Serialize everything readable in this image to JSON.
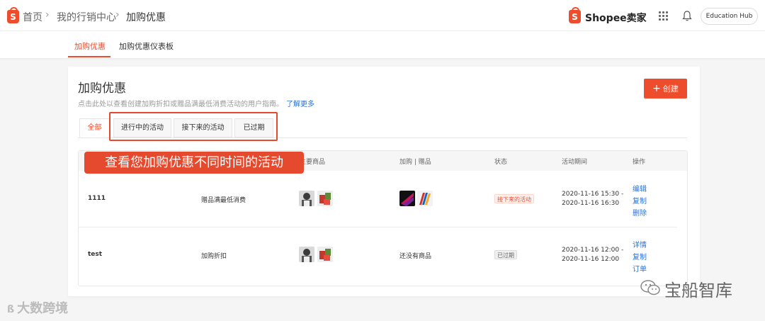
{
  "header": {
    "breadcrumbs": [
      "首页",
      "我的行销中心",
      "加购优惠"
    ],
    "brand": "Shopee卖家",
    "hub_button": "Education Hub",
    "icons": [
      "shopee-logo-icon",
      "grid-apps-icon",
      "bell-icon"
    ]
  },
  "subnav": {
    "tabs": [
      {
        "label": "加购优惠",
        "active": true
      },
      {
        "label": "加购优惠仪表板",
        "active": false
      }
    ]
  },
  "page": {
    "title": "加购优惠",
    "description": "点击此处以查看创建加购折扣或赠品满最低消费活动的用户指南。",
    "learn_more": "了解更多",
    "create_button": "创建"
  },
  "status_tabs": [
    {
      "label": "全部",
      "active": true
    },
    {
      "label": "进行中的活动",
      "active": false
    },
    {
      "label": "接下来的活动",
      "active": false
    },
    {
      "label": "已过期",
      "active": false
    }
  ],
  "callout": "查看您加购优惠不同时间的活动",
  "table": {
    "columns": [
      "主要商品",
      "加购 | 赠品",
      "状态",
      "活动期间",
      "操作"
    ],
    "rows": [
      {
        "name": "1111",
        "type": "赠品满最低消费",
        "addon_text": "",
        "status": "接下来的活动",
        "status_color": "#ee4d2d",
        "period_start": "2020-11-16 15:30 -",
        "period_end": "2020-11-16 16:30",
        "actions": [
          "编辑",
          "复制",
          "删除"
        ]
      },
      {
        "name": "test",
        "type": "加购折扣",
        "addon_text": "还没有商品",
        "status": "已过期",
        "status_color": "#666666",
        "period_start": "2020-11-16 12:00 -",
        "period_end": "2020-11-16 12:00",
        "actions": [
          "详情",
          "复制",
          "订单"
        ]
      }
    ]
  },
  "watermarks": {
    "left": "大数跨境",
    "right": "宝船智库"
  },
  "colors": {
    "accent": "#ee4d2d",
    "link": "#2673dd",
    "callout": "#e64a2e"
  }
}
